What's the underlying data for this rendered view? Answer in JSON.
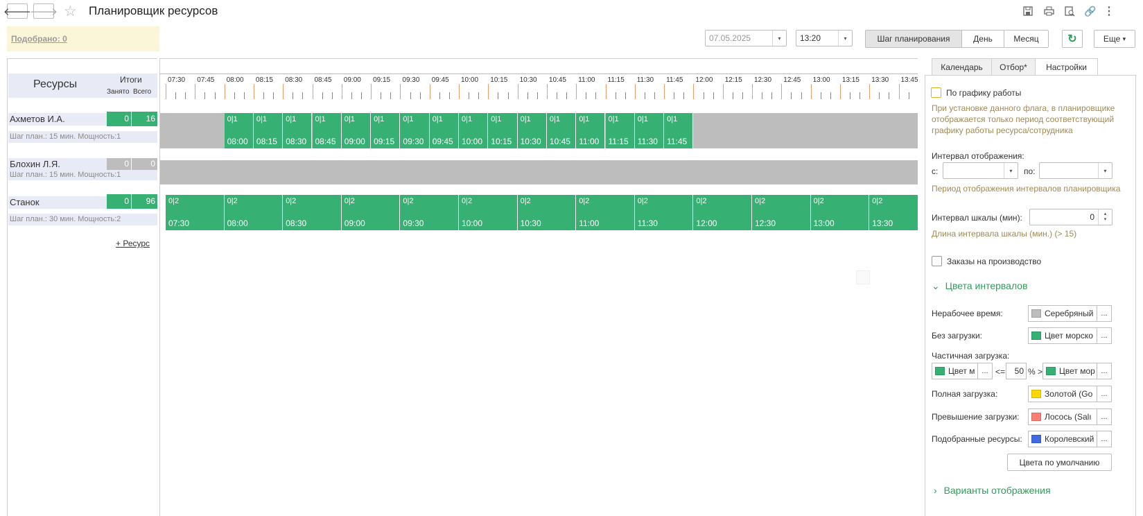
{
  "window": {
    "title": "Планировщик ресурсов",
    "back_icon": "arrow-left-icon",
    "forward_icon": "arrow-right-icon"
  },
  "header": {
    "selected_label": "Подобрано: 0",
    "date_value": "07.05.2025",
    "time_value": "13:20",
    "segments": [
      "Шаг планирования",
      "День",
      "Месяц"
    ],
    "active_segment": "Шаг планирования",
    "more_label": "Еще",
    "more_arrow": "▾"
  },
  "resources": {
    "header": "Ресурсы",
    "totals_header": "Итоги",
    "busy_label": "Занято",
    "total_label": "Всего",
    "add_label": "+ Ресурс",
    "items": [
      {
        "name": "Ахметов И.А.",
        "info": "Шаг план.: 15 мин. Мощность:1",
        "busy": "0",
        "total": "16"
      },
      {
        "name": "Блохин Л.Я.",
        "info": "Шаг план.: 15 мин. Мощность:1",
        "busy": "0",
        "total": "0"
      },
      {
        "name": "Станок",
        "info": "Шаг план.: 30 мин. Мощность:2",
        "busy": "0",
        "total": "96"
      }
    ]
  },
  "timeline": {
    "scale_labels": [
      "07:30",
      "07:45",
      "08:00",
      "08:15",
      "08:30",
      "08:45",
      "09:00",
      "09:15",
      "09:30",
      "09:45",
      "10:00",
      "10:15",
      "10:30",
      "10:45",
      "11:00",
      "11:15",
      "11:30",
      "11:45",
      "12:00",
      "12:15",
      "12:30",
      "12:45",
      "13:00",
      "13:15",
      "13:30",
      "13:45"
    ],
    "row1": {
      "load": "0|1",
      "times": [
        "08:00",
        "08:15",
        "08:30",
        "08:45",
        "09:00",
        "09:15",
        "09:30",
        "09:45",
        "10:00",
        "10:15",
        "10:30",
        "10:45",
        "11:00",
        "11:15",
        "11:30",
        "11:45"
      ]
    },
    "row3": {
      "load": "0|2",
      "times": [
        "07:30",
        "08:00",
        "08:30",
        "09:00",
        "09:30",
        "10:00",
        "10:30",
        "11:00",
        "11:30",
        "12:00",
        "12:30",
        "13:00",
        "13:30"
      ]
    }
  },
  "settings": {
    "tabs": [
      "Календарь",
      "Отбор*",
      "Настройки"
    ],
    "active_tab": "Настройки",
    "by_schedule_label": "По графику работы",
    "by_schedule_hint": "При установке данного флага, в планировщике отображается только период соответствующий графику работы ресурса/сотрудника",
    "interval_label": "Интервал отображения:",
    "from_label": "с:",
    "to_label": "по:",
    "interval_hint": "Период отображения интервалов планировщика",
    "scale_label": "Интервал шкалы (мин):",
    "scale_value": "0",
    "scale_hint": "Длина интервала шкалы (мин.) (> 15)",
    "orders_label": "Заказы на производство",
    "colors_section": "Цвета интервалов",
    "nonworking_label": "Нерабочее время:",
    "nonworking_color": {
      "name": "Серебряный",
      "hex": "#bdbdbd"
    },
    "noload_label": "Без загрузки:",
    "noload_color": {
      "name": "Цвет морско",
      "hex": "#36b073"
    },
    "partial_label": "Частичная загрузка:",
    "partial_low_color": {
      "name": "Цвет м",
      "hex": "#36b073"
    },
    "partial_le": "<=",
    "partial_value": "50",
    "partial_gt": "% >",
    "partial_high_color": {
      "name": "Цвет мор",
      "hex": "#36b073"
    },
    "full_label": "Полная загрузка:",
    "full_color": {
      "name": "Золотой (Go",
      "hex": "#ffd700"
    },
    "over_label": "Превышение загрузки:",
    "over_color": {
      "name": "Лосось (Salı",
      "hex": "#fa8072"
    },
    "picked_label": "Подобранные ресурсы:",
    "picked_color": {
      "name": "Королевский",
      "hex": "#4169e1"
    },
    "default_colors_btn": "Цвета по умолчанию",
    "variants_section": "Варианты отображения",
    "dots": "..."
  }
}
